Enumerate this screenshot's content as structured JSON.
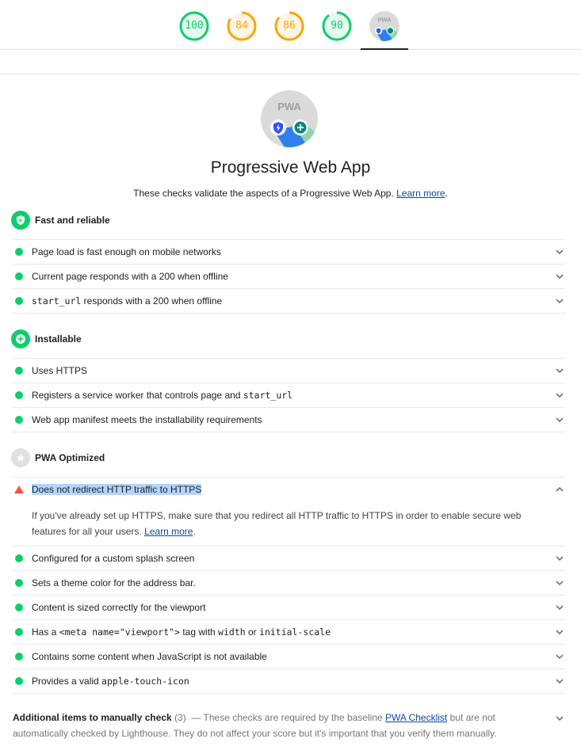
{
  "top_gauges": [
    {
      "name": "performance",
      "score": "100",
      "value": 100,
      "status": "pass",
      "color": "#0cce6b"
    },
    {
      "name": "accessibility",
      "score": "84",
      "value": 84,
      "status": "average",
      "color": "#ffa400"
    },
    {
      "name": "best-practices",
      "score": "86",
      "value": 86,
      "status": "average",
      "color": "#ffa400"
    },
    {
      "name": "seo",
      "score": "90",
      "value": 90,
      "status": "pass",
      "color": "#0cce6b"
    }
  ],
  "pwa_badge": {
    "label": "PWA",
    "active_tab": true
  },
  "category": {
    "title": "Progressive Web App",
    "description": "These checks validate the aspects of a Progressive Web App.",
    "learn_more": "Learn more",
    "period": "."
  },
  "groups": [
    {
      "title": "Fast and reliable",
      "icon": "lightning-shield-icon",
      "color": "#0cce6b",
      "audits": [
        {
          "status": "pass",
          "parts": [
            {
              "t": "Page load is fast enough on mobile networks"
            }
          ]
        },
        {
          "status": "pass",
          "parts": [
            {
              "t": "Current page responds with a 200 when offline"
            }
          ]
        },
        {
          "status": "pass",
          "parts": [
            {
              "t": "start_url",
              "code": true
            },
            {
              "t": " responds with a 200 when offline"
            }
          ]
        }
      ]
    },
    {
      "title": "Installable",
      "icon": "plus-circle-icon",
      "color": "#0cce6b",
      "audits": [
        {
          "status": "pass",
          "parts": [
            {
              "t": "Uses HTTPS"
            }
          ]
        },
        {
          "status": "pass",
          "parts": [
            {
              "t": "Registers a service worker that controls page and "
            },
            {
              "t": "start_url",
              "code": true
            }
          ]
        },
        {
          "status": "pass",
          "parts": [
            {
              "t": "Web app manifest meets the installability requirements"
            }
          ]
        }
      ]
    },
    {
      "title": "PWA Optimized",
      "icon": "star-icon",
      "color": "#e0e0e0",
      "audits": [
        {
          "status": "fail",
          "expanded": true,
          "parts": [
            {
              "t": "Does not redirect HTTP traffic to HTTPS"
            }
          ]
        },
        {
          "status": "pass",
          "parts": [
            {
              "t": "Configured for a custom splash screen"
            }
          ]
        },
        {
          "status": "pass",
          "parts": [
            {
              "t": "Sets a theme color for the address bar."
            }
          ]
        },
        {
          "status": "pass",
          "parts": [
            {
              "t": "Content is sized correctly for the viewport"
            }
          ]
        },
        {
          "status": "pass",
          "parts": [
            {
              "t": "Has a "
            },
            {
              "t": "<meta name=\"viewport\">",
              "code": true
            },
            {
              "t": " tag with "
            },
            {
              "t": "width",
              "code": true
            },
            {
              "t": " or "
            },
            {
              "t": "initial-scale",
              "code": true
            }
          ]
        },
        {
          "status": "pass",
          "parts": [
            {
              "t": "Contains some content when JavaScript is not available"
            }
          ]
        },
        {
          "status": "pass",
          "parts": [
            {
              "t": "Provides a valid "
            },
            {
              "t": "apple-touch-icon",
              "code": true
            }
          ]
        }
      ]
    }
  ],
  "expanded_audit": {
    "description": "If you've already set up HTTPS, make sure that you redirect all HTTP traffic to HTTPS in order to enable secure web features for all your users.",
    "learn_more": "Learn more",
    "period": "."
  },
  "manual_checks": {
    "title": "Additional items to manually check",
    "count": "(3)",
    "dash": "—",
    "text_before": "These checks are required by the baseline",
    "link": "PWA Checklist",
    "text_after": "but are not automatically checked by Lighthouse. They do not affect your score but it's important that you verify them manually."
  },
  "colors": {
    "pass": "#0cce6b",
    "average": "#ffa400",
    "fail": "#ff4e42",
    "link": "#0d47a1",
    "selection": "#b3d4fc"
  }
}
